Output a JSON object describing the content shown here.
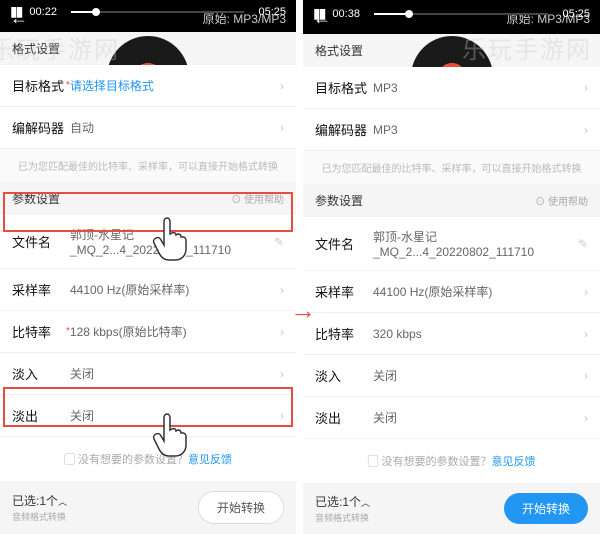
{
  "watermark": "乐玩手游网",
  "arrow": "→",
  "player": {
    "origin_label": "原始: MP3/MP3",
    "duration": "05:25"
  },
  "left": {
    "time": "00:22",
    "progress_pct": 12,
    "format_section": "格式设置",
    "target_label": "目标格式",
    "target_value": "请选择目标格式",
    "codec_label": "编解码器",
    "codec_value": "自动",
    "hint": "已为您匹配最佳的比特率、采样率，可以直接开始格式转换",
    "param_section": "参数设置",
    "help": "⊙ 使用帮助",
    "filename_label": "文件名",
    "filename_value": "郭顶-水星记_MQ_2...4_20220802_111710",
    "samplerate_label": "采样率",
    "samplerate_value": "44100 Hz(原始采样率)",
    "bitrate_label": "比特率",
    "bitrate_value": "128 kbps(原始比特率)",
    "fadein_label": "淡入",
    "fadein_value": "关闭",
    "fadeout_label": "淡出",
    "fadeout_value": "关闭",
    "feedback_text": "▢ 没有想要的参数设置？",
    "feedback_link": "意见反馈",
    "selected": "已选:1个",
    "selected_sub": "音频格式转换",
    "button": "开始转换"
  },
  "right": {
    "time": "00:38",
    "progress_pct": 18,
    "format_section": "格式设置",
    "target_label": "目标格式",
    "target_value": "MP3",
    "codec_label": "编解码器",
    "codec_value": "MP3",
    "hint": "已为您匹配最佳的比特率、采样率，可以直接开始格式转换",
    "param_section": "参数设置",
    "help": "⊙ 使用帮助",
    "filename_label": "文件名",
    "filename_value": "郭顶-水星记_MQ_2...4_20220802_111710",
    "samplerate_label": "采样率",
    "samplerate_value": "44100 Hz(原始采样率)",
    "bitrate_label": "比特率",
    "bitrate_value": "320 kbps",
    "fadein_label": "淡入",
    "fadein_value": "关闭",
    "fadeout_label": "淡出",
    "fadeout_value": "关闭",
    "feedback_text": "▢ 没有想要的参数设置？",
    "feedback_link": "意见反馈",
    "selected": "已选:1个",
    "selected_sub": "音频格式转换",
    "button": "开始转换"
  }
}
